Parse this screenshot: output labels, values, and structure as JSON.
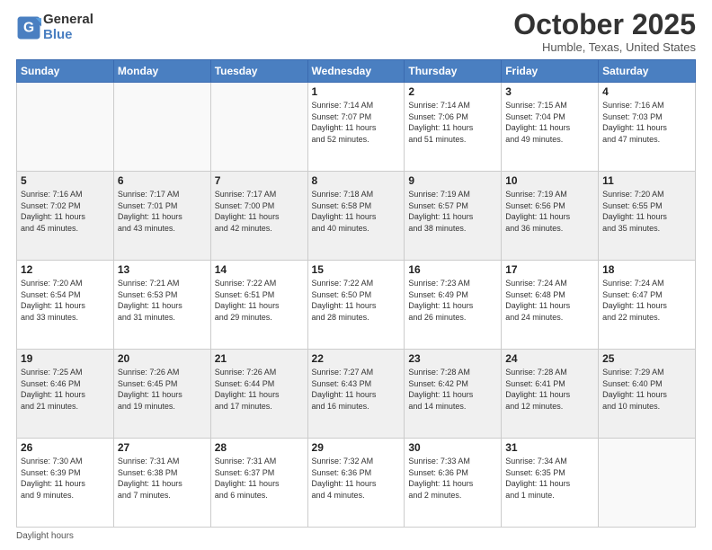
{
  "header": {
    "logo_line1": "General",
    "logo_line2": "Blue",
    "month": "October 2025",
    "location": "Humble, Texas, United States"
  },
  "days_of_week": [
    "Sunday",
    "Monday",
    "Tuesday",
    "Wednesday",
    "Thursday",
    "Friday",
    "Saturday"
  ],
  "weeks": [
    [
      {
        "day": "",
        "info": ""
      },
      {
        "day": "",
        "info": ""
      },
      {
        "day": "",
        "info": ""
      },
      {
        "day": "1",
        "info": "Sunrise: 7:14 AM\nSunset: 7:07 PM\nDaylight: 11 hours\nand 52 minutes."
      },
      {
        "day": "2",
        "info": "Sunrise: 7:14 AM\nSunset: 7:06 PM\nDaylight: 11 hours\nand 51 minutes."
      },
      {
        "day": "3",
        "info": "Sunrise: 7:15 AM\nSunset: 7:04 PM\nDaylight: 11 hours\nand 49 minutes."
      },
      {
        "day": "4",
        "info": "Sunrise: 7:16 AM\nSunset: 7:03 PM\nDaylight: 11 hours\nand 47 minutes."
      }
    ],
    [
      {
        "day": "5",
        "info": "Sunrise: 7:16 AM\nSunset: 7:02 PM\nDaylight: 11 hours\nand 45 minutes."
      },
      {
        "day": "6",
        "info": "Sunrise: 7:17 AM\nSunset: 7:01 PM\nDaylight: 11 hours\nand 43 minutes."
      },
      {
        "day": "7",
        "info": "Sunrise: 7:17 AM\nSunset: 7:00 PM\nDaylight: 11 hours\nand 42 minutes."
      },
      {
        "day": "8",
        "info": "Sunrise: 7:18 AM\nSunset: 6:58 PM\nDaylight: 11 hours\nand 40 minutes."
      },
      {
        "day": "9",
        "info": "Sunrise: 7:19 AM\nSunset: 6:57 PM\nDaylight: 11 hours\nand 38 minutes."
      },
      {
        "day": "10",
        "info": "Sunrise: 7:19 AM\nSunset: 6:56 PM\nDaylight: 11 hours\nand 36 minutes."
      },
      {
        "day": "11",
        "info": "Sunrise: 7:20 AM\nSunset: 6:55 PM\nDaylight: 11 hours\nand 35 minutes."
      }
    ],
    [
      {
        "day": "12",
        "info": "Sunrise: 7:20 AM\nSunset: 6:54 PM\nDaylight: 11 hours\nand 33 minutes."
      },
      {
        "day": "13",
        "info": "Sunrise: 7:21 AM\nSunset: 6:53 PM\nDaylight: 11 hours\nand 31 minutes."
      },
      {
        "day": "14",
        "info": "Sunrise: 7:22 AM\nSunset: 6:51 PM\nDaylight: 11 hours\nand 29 minutes."
      },
      {
        "day": "15",
        "info": "Sunrise: 7:22 AM\nSunset: 6:50 PM\nDaylight: 11 hours\nand 28 minutes."
      },
      {
        "day": "16",
        "info": "Sunrise: 7:23 AM\nSunset: 6:49 PM\nDaylight: 11 hours\nand 26 minutes."
      },
      {
        "day": "17",
        "info": "Sunrise: 7:24 AM\nSunset: 6:48 PM\nDaylight: 11 hours\nand 24 minutes."
      },
      {
        "day": "18",
        "info": "Sunrise: 7:24 AM\nSunset: 6:47 PM\nDaylight: 11 hours\nand 22 minutes."
      }
    ],
    [
      {
        "day": "19",
        "info": "Sunrise: 7:25 AM\nSunset: 6:46 PM\nDaylight: 11 hours\nand 21 minutes."
      },
      {
        "day": "20",
        "info": "Sunrise: 7:26 AM\nSunset: 6:45 PM\nDaylight: 11 hours\nand 19 minutes."
      },
      {
        "day": "21",
        "info": "Sunrise: 7:26 AM\nSunset: 6:44 PM\nDaylight: 11 hours\nand 17 minutes."
      },
      {
        "day": "22",
        "info": "Sunrise: 7:27 AM\nSunset: 6:43 PM\nDaylight: 11 hours\nand 16 minutes."
      },
      {
        "day": "23",
        "info": "Sunrise: 7:28 AM\nSunset: 6:42 PM\nDaylight: 11 hours\nand 14 minutes."
      },
      {
        "day": "24",
        "info": "Sunrise: 7:28 AM\nSunset: 6:41 PM\nDaylight: 11 hours\nand 12 minutes."
      },
      {
        "day": "25",
        "info": "Sunrise: 7:29 AM\nSunset: 6:40 PM\nDaylight: 11 hours\nand 10 minutes."
      }
    ],
    [
      {
        "day": "26",
        "info": "Sunrise: 7:30 AM\nSunset: 6:39 PM\nDaylight: 11 hours\nand 9 minutes."
      },
      {
        "day": "27",
        "info": "Sunrise: 7:31 AM\nSunset: 6:38 PM\nDaylight: 11 hours\nand 7 minutes."
      },
      {
        "day": "28",
        "info": "Sunrise: 7:31 AM\nSunset: 6:37 PM\nDaylight: 11 hours\nand 6 minutes."
      },
      {
        "day": "29",
        "info": "Sunrise: 7:32 AM\nSunset: 6:36 PM\nDaylight: 11 hours\nand 4 minutes."
      },
      {
        "day": "30",
        "info": "Sunrise: 7:33 AM\nSunset: 6:36 PM\nDaylight: 11 hours\nand 2 minutes."
      },
      {
        "day": "31",
        "info": "Sunrise: 7:34 AM\nSunset: 6:35 PM\nDaylight: 11 hours\nand 1 minute."
      },
      {
        "day": "",
        "info": ""
      }
    ]
  ],
  "footer": {
    "note": "Daylight hours"
  }
}
